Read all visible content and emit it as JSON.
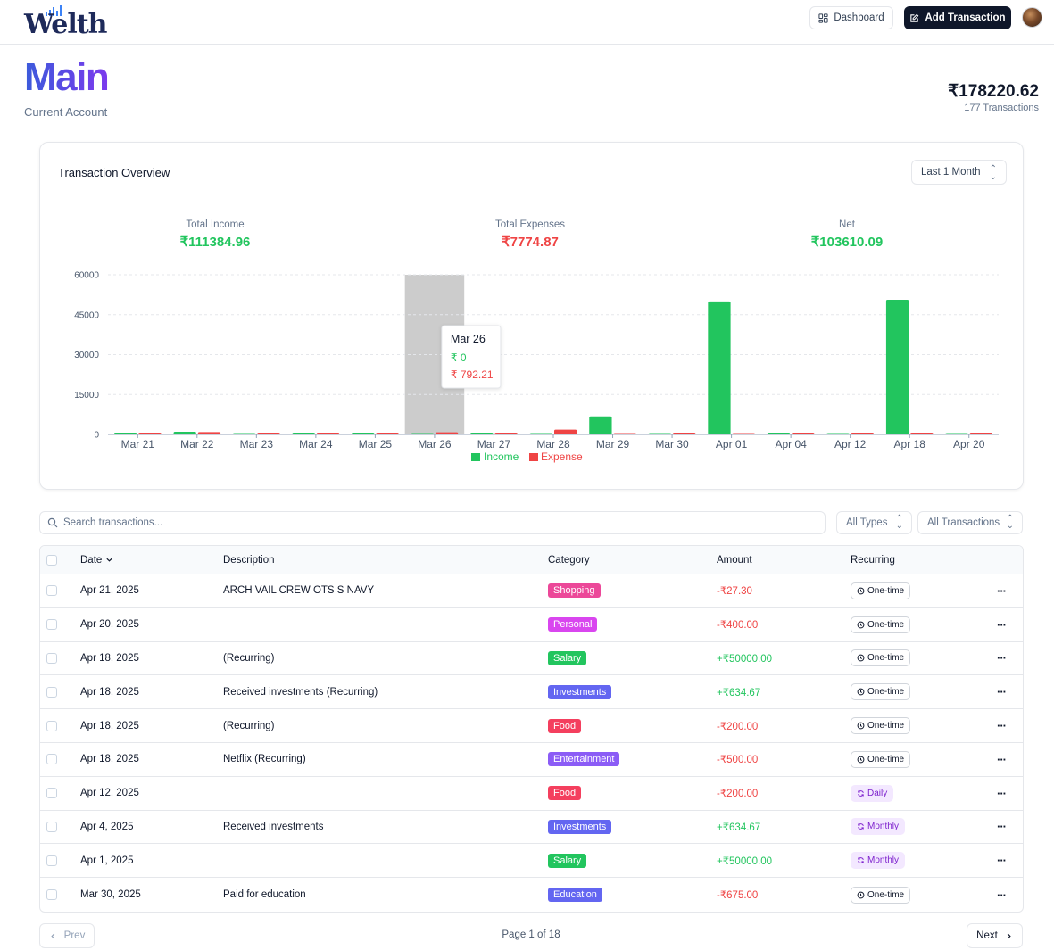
{
  "app": {
    "logo_text": "Welth",
    "dashboard_label": "Dashboard",
    "add_transaction_label": "Add Transaction"
  },
  "account": {
    "name": "Main",
    "type": "Current Account",
    "balance": "₹178220.62",
    "transaction_count": "177 Transactions"
  },
  "overview": {
    "title": "Transaction Overview",
    "range": "Last 1 Month",
    "stats": {
      "income_label": "Total Income",
      "income_value": "₹111384.96",
      "expense_label": "Total Expenses",
      "expense_value": "₹7774.87",
      "net_label": "Net",
      "net_value": "₹103610.09"
    },
    "colors": {
      "income": "#22c55e",
      "expense": "#ef4444",
      "hover": "#cccccc"
    }
  },
  "chart_data": {
    "type": "bar",
    "categories": [
      "Mar 21",
      "Mar 22",
      "Mar 23",
      "Mar 24",
      "Mar 25",
      "Mar 26",
      "Mar 27",
      "Mar 28",
      "Mar 29",
      "Mar 30",
      "Apr 01",
      "Apr 04",
      "Apr 12",
      "Apr 18",
      "Apr 20"
    ],
    "series": [
      {
        "name": "Income",
        "values": [
          150,
          1000,
          0,
          500,
          600,
          0,
          200,
          0,
          6800,
          0,
          50000,
          634.67,
          0,
          50634.67,
          0
        ]
      },
      {
        "name": "Expense",
        "values": [
          100,
          900,
          150,
          200,
          600,
          792.21,
          150,
          1800,
          0,
          600,
          0,
          150,
          300,
          600,
          400
        ]
      }
    ],
    "ylim": [
      0,
      60000
    ],
    "yticks": [
      0,
      15000,
      30000,
      45000,
      60000
    ],
    "legend_position": "bottom",
    "highlighted_category": "Mar 26",
    "tooltip": {
      "title": "Mar 26",
      "income": "₹ 0",
      "expense": "₹ 792.21"
    }
  },
  "filters": {
    "search_placeholder": "Search transactions...",
    "type_filter": "All Types",
    "recurring_filter": "All Transactions"
  },
  "table": {
    "headers": {
      "date": "Date",
      "description": "Description",
      "category": "Category",
      "amount": "Amount",
      "recurring": "Recurring"
    },
    "rows": [
      {
        "date": "Apr 21, 2025",
        "description": "ARCH VAIL CREW OTS S NAVY",
        "category": "Shopping",
        "category_color": "#ec4899",
        "amount": "-₹27.30",
        "type": "expense",
        "recurring": "One-time",
        "recurring_kind": "one"
      },
      {
        "date": "Apr 20, 2025",
        "description": "",
        "category": "Personal",
        "category_color": "#d946ef",
        "amount": "-₹400.00",
        "type": "expense",
        "recurring": "One-time",
        "recurring_kind": "one"
      },
      {
        "date": "Apr 18, 2025",
        "description": "(Recurring)",
        "category": "Salary",
        "category_color": "#22c55e",
        "amount": "+₹50000.00",
        "type": "income",
        "recurring": "One-time",
        "recurring_kind": "one"
      },
      {
        "date": "Apr 18, 2025",
        "description": "Received investments (Recurring)",
        "category": "Investments",
        "category_color": "#6366f1",
        "amount": "+₹634.67",
        "type": "income",
        "recurring": "One-time",
        "recurring_kind": "one"
      },
      {
        "date": "Apr 18, 2025",
        "description": "(Recurring)",
        "category": "Food",
        "category_color": "#f43f5e",
        "amount": "-₹200.00",
        "type": "expense",
        "recurring": "One-time",
        "recurring_kind": "one"
      },
      {
        "date": "Apr 18, 2025",
        "description": "Netflix (Recurring)",
        "category": "Entertainment",
        "category_color": "#8b5cf6",
        "amount": "-₹500.00",
        "type": "expense",
        "recurring": "One-time",
        "recurring_kind": "one"
      },
      {
        "date": "Apr 12, 2025",
        "description": "",
        "category": "Food",
        "category_color": "#f43f5e",
        "amount": "-₹200.00",
        "type": "expense",
        "recurring": "Daily",
        "recurring_kind": "repeat"
      },
      {
        "date": "Apr 4, 2025",
        "description": "Received investments",
        "category": "Investments",
        "category_color": "#6366f1",
        "amount": "+₹634.67",
        "type": "income",
        "recurring": "Monthly",
        "recurring_kind": "repeat"
      },
      {
        "date": "Apr 1, 2025",
        "description": "",
        "category": "Salary",
        "category_color": "#22c55e",
        "amount": "+₹50000.00",
        "type": "income",
        "recurring": "Monthly",
        "recurring_kind": "repeat"
      },
      {
        "date": "Mar 30, 2025",
        "description": "Paid for education",
        "category": "Education",
        "category_color": "#6366f1",
        "amount": "-₹675.00",
        "type": "expense",
        "recurring": "One-time",
        "recurring_kind": "one"
      }
    ]
  },
  "pagination": {
    "prev_label": "Prev",
    "page_info": "Page 1 of 18",
    "next_label": "Next"
  }
}
